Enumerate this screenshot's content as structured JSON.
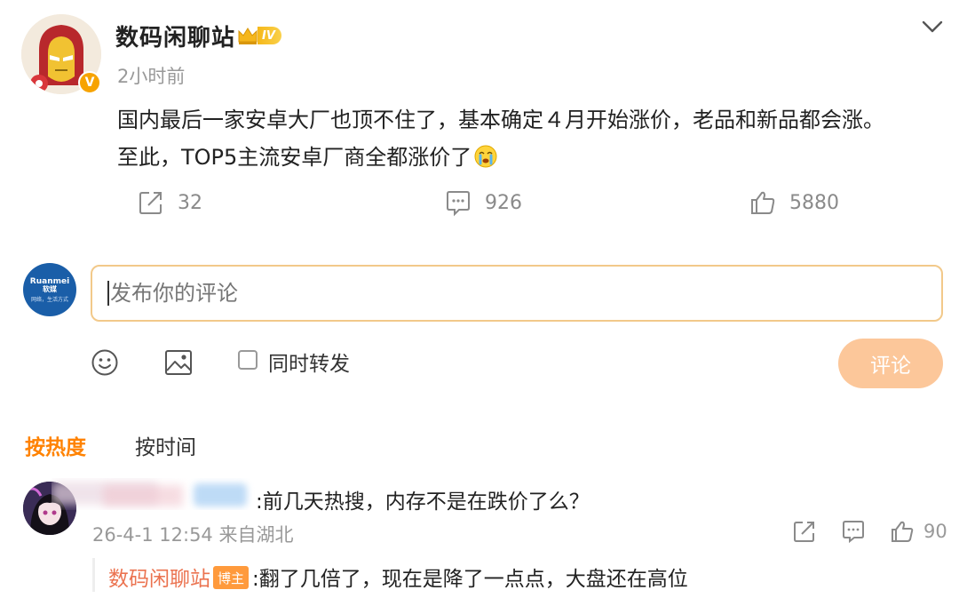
{
  "post": {
    "author": "数码闲聊站",
    "level_badge": "IV",
    "verified_mark": "V",
    "time": "2小时前",
    "content_line1": "国内最后一家安卓大厂也顶不住了，基本确定４月开始涨价，老品和新品都会涨。",
    "content_line2": "至此，TOP5主流安卓厂商全都涨价了",
    "reposts": "32",
    "comments": "926",
    "likes": "5880"
  },
  "composer": {
    "placeholder": "发布你的评论",
    "avatar_text": "Ruanmei",
    "avatar_subtext": "软媒",
    "avatar_tagline": "网络，生活方式",
    "repost_label": "同时转发",
    "submit_label": "评论"
  },
  "sort_tabs": {
    "hot": "按热度",
    "time": "按时间"
  },
  "comments": [
    {
      "text": ":前几天热搜，内存不是在跌价了么？",
      "meta": "26-4-1 12:54 来自湖北",
      "likes": "90",
      "reply": {
        "author": "数码闲聊站",
        "tag": "博主",
        "text": ":翻了几倍了，现在是降了一点点，大盘还在高位"
      }
    }
  ],
  "icons": {
    "more": "chevron-down-icon",
    "repost": "repost-icon",
    "comment": "comment-icon",
    "like": "thumbs-up-icon",
    "emoji": "smiley-icon",
    "image": "image-icon"
  },
  "colors": {
    "accent_orange": "#ff8200",
    "submit_disabled": "#fcc79a",
    "input_border": "#f2c98a",
    "reply_author": "#eb7350"
  }
}
